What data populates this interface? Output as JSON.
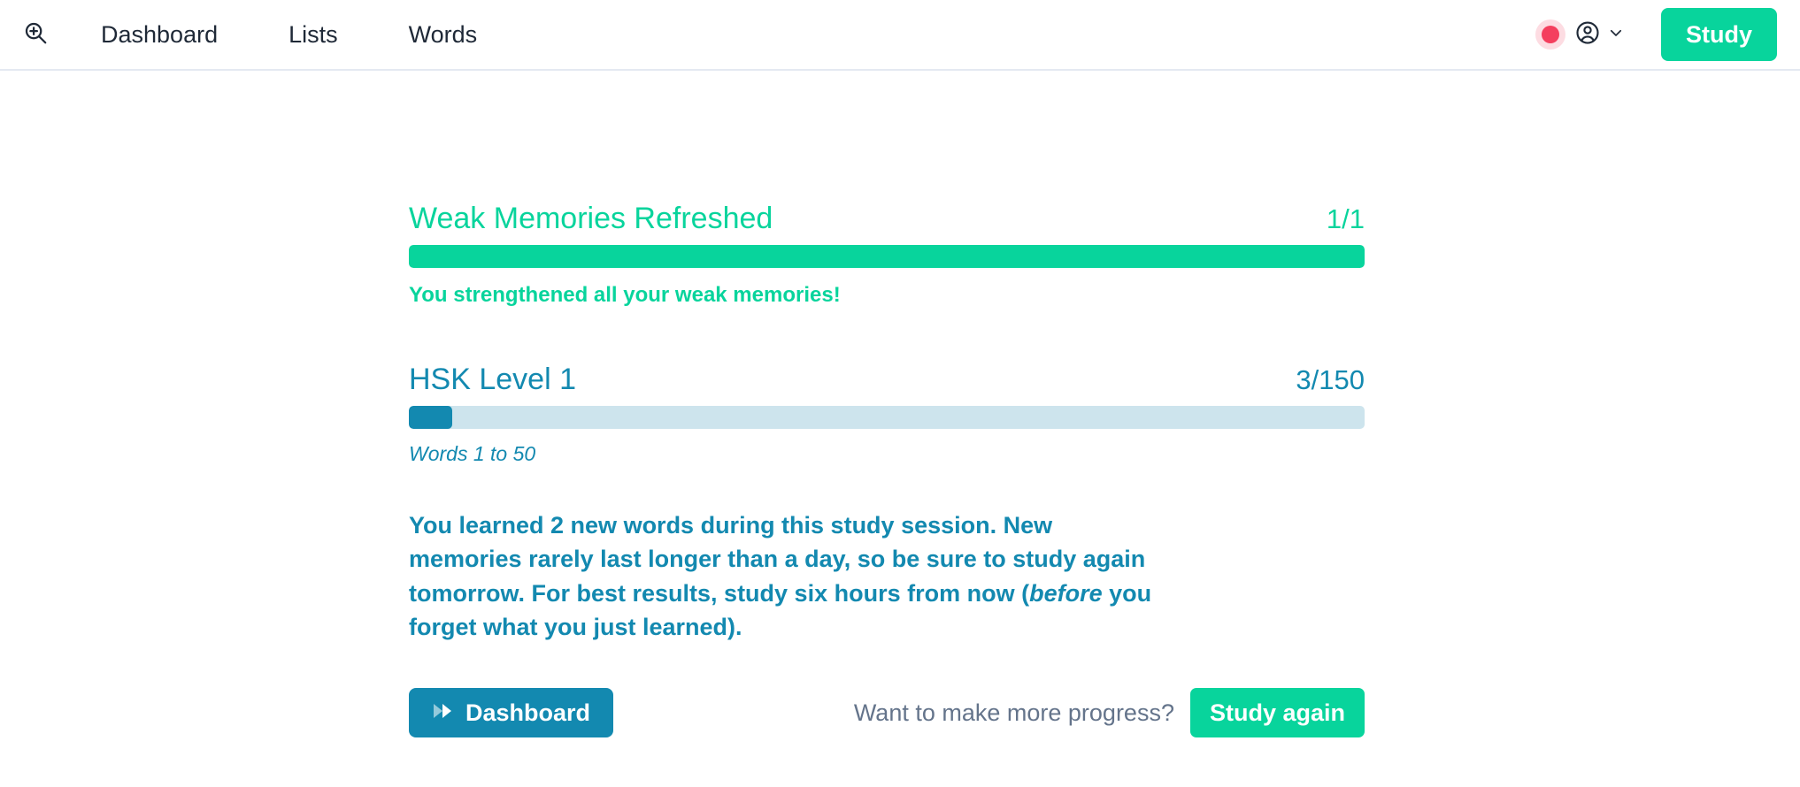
{
  "header": {
    "zoom_icon": "zoom-in-icon",
    "nav_items": [
      {
        "label": "Dashboard"
      },
      {
        "label": "Lists"
      },
      {
        "label": "Words"
      }
    ],
    "status_dot_color": "#f43f5e",
    "account_icon": "user-circle-icon",
    "account_chevron_icon": "chevron-down-icon",
    "study_button_label": "Study",
    "study_button_color": "#08d49c",
    "border_color": "#e4e9f2"
  },
  "main": {
    "weak_memories": {
      "title": "Weak Memories Refreshed",
      "count": "1/1",
      "percent": 100,
      "caption": "You strengthened all your weak memories!",
      "accent_color": "#08d49c",
      "track_color": "#d4f5ec"
    },
    "hsk_level": {
      "title": "HSK Level 1",
      "count": "3/150",
      "percent": 4.5,
      "caption": "Words 1 to 50",
      "accent_color": "#1389b0",
      "track_color": "#cde4ed"
    },
    "summary": {
      "part1": "You learned 2 new words during this study session. New memories rarely last longer than a day, so be sure to study again tomorrow. For best results, study six hours from now (",
      "emphasis": "before",
      "part2": " you forget what you just learned).",
      "color": "#1389b0"
    },
    "actions": {
      "dashboard_icon": "fast-forward-icon",
      "dashboard_label": "Dashboard",
      "dashboard_color": "#1389b0",
      "prompt": "Want to make more progress?",
      "prompt_color": "#64748b",
      "study_again_label": "Study again",
      "study_again_color": "#08d49c"
    }
  }
}
